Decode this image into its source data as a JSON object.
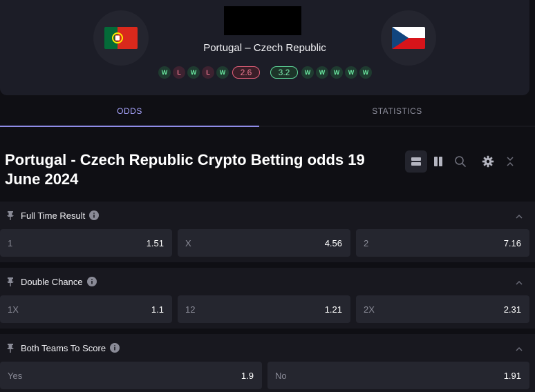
{
  "match": {
    "title": "Portugal – Czech Republic",
    "home": {
      "team": "Portugal",
      "flag_colors": [
        "#046a38",
        "#da291c",
        "#ffe900"
      ],
      "form": [
        "W",
        "L",
        "W",
        "L",
        "W"
      ],
      "rating": "2.6"
    },
    "away": {
      "team": "Czech Republic",
      "flag_colors": [
        "#ffffff",
        "#d7141a",
        "#11457e"
      ],
      "form": [
        "W",
        "W",
        "W",
        "W",
        "W"
      ],
      "rating": "3.2"
    }
  },
  "tabs": [
    {
      "label": "ODDS",
      "active": true
    },
    {
      "label": "STATISTICS",
      "active": false
    }
  ],
  "page_title": "Portugal - Czech Republic Crypto Betting odds 19 June 2024",
  "toolbar": {
    "icons": [
      "rows-layout-icon",
      "columns-layout-icon",
      "search-icon",
      "gear-icon",
      "collapse-all-icon"
    ]
  },
  "markets": [
    {
      "name": "Full Time Result",
      "odds": [
        {
          "label": "1",
          "value": "1.51"
        },
        {
          "label": "X",
          "value": "4.56"
        },
        {
          "label": "2",
          "value": "7.16"
        }
      ]
    },
    {
      "name": "Double Chance",
      "odds": [
        {
          "label": "1X",
          "value": "1.1"
        },
        {
          "label": "12",
          "value": "1.21"
        },
        {
          "label": "2X",
          "value": "2.31"
        }
      ]
    },
    {
      "name": "Both Teams To Score",
      "odds": [
        {
          "label": "Yes",
          "value": "1.9"
        },
        {
          "label": "No",
          "value": "1.91"
        }
      ]
    }
  ],
  "colors": {
    "accent": "#a9a6ff",
    "win": "#6be8a0",
    "loss": "#f07a92",
    "background": "#0f0f14",
    "panel": "#18181f"
  }
}
